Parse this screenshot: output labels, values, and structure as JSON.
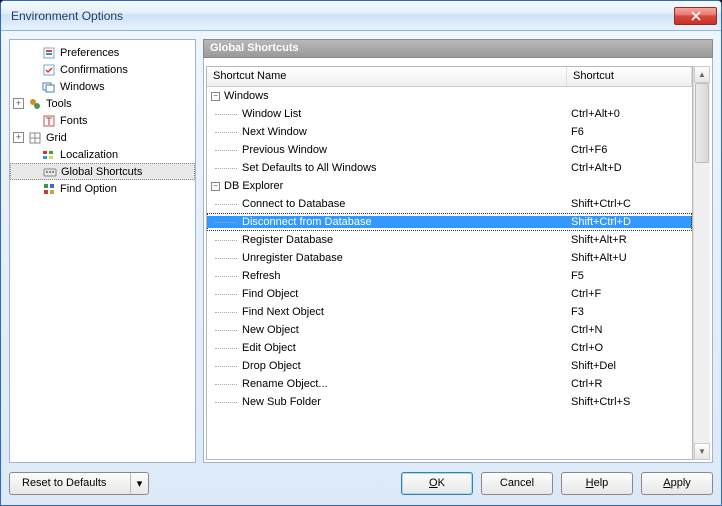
{
  "window": {
    "title": "Environment Options"
  },
  "tree": [
    {
      "label": "Preferences",
      "indent": 1,
      "expand": null,
      "icon": "prefs"
    },
    {
      "label": "Confirmations",
      "indent": 1,
      "expand": null,
      "icon": "confirm"
    },
    {
      "label": "Windows",
      "indent": 1,
      "expand": null,
      "icon": "windows"
    },
    {
      "label": "Tools",
      "indent": 0,
      "expand": "+",
      "icon": "tools"
    },
    {
      "label": "Fonts",
      "indent": 1,
      "expand": null,
      "icon": "fonts"
    },
    {
      "label": "Grid",
      "indent": 0,
      "expand": "+",
      "icon": "grid"
    },
    {
      "label": "Localization",
      "indent": 1,
      "expand": null,
      "icon": "local"
    },
    {
      "label": "Global Shortcuts",
      "indent": 1,
      "expand": null,
      "icon": "shortcut",
      "selected": true
    },
    {
      "label": "Find Option",
      "indent": 1,
      "expand": null,
      "icon": "find"
    }
  ],
  "section": {
    "title": "Global Shortcuts"
  },
  "columns": {
    "name": "Shortcut Name",
    "shortcut": "Shortcut"
  },
  "rows": [
    {
      "type": "group",
      "name": "Windows",
      "shortcut": ""
    },
    {
      "type": "item",
      "name": "Window List",
      "shortcut": "Ctrl+Alt+0"
    },
    {
      "type": "item",
      "name": "Next Window",
      "shortcut": "F6"
    },
    {
      "type": "item",
      "name": "Previous Window",
      "shortcut": "Ctrl+F6"
    },
    {
      "type": "item",
      "name": "Set Defaults to All Windows",
      "shortcut": "Ctrl+Alt+D"
    },
    {
      "type": "group",
      "name": "DB Explorer",
      "shortcut": ""
    },
    {
      "type": "item",
      "name": "Connect to Database",
      "shortcut": "Shift+Ctrl+C"
    },
    {
      "type": "item",
      "name": "Disconnect from Database",
      "shortcut": "Shift+Ctrl+D",
      "selected": true
    },
    {
      "type": "item",
      "name": "Register Database",
      "shortcut": "Shift+Alt+R"
    },
    {
      "type": "item",
      "name": "Unregister Database",
      "shortcut": "Shift+Alt+U"
    },
    {
      "type": "item",
      "name": "Refresh",
      "shortcut": "F5"
    },
    {
      "type": "item",
      "name": "Find Object",
      "shortcut": "Ctrl+F"
    },
    {
      "type": "item",
      "name": "Find Next Object",
      "shortcut": "F3"
    },
    {
      "type": "item",
      "name": "New Object",
      "shortcut": "Ctrl+N"
    },
    {
      "type": "item",
      "name": "Edit Object",
      "shortcut": "Ctrl+O"
    },
    {
      "type": "item",
      "name": "Drop Object",
      "shortcut": "Shift+Del"
    },
    {
      "type": "item",
      "name": "Rename Object...",
      "shortcut": "Ctrl+R"
    },
    {
      "type": "item",
      "name": "New Sub Folder",
      "shortcut": "Shift+Ctrl+S"
    }
  ],
  "buttons": {
    "reset": "Reset to Defaults",
    "ok": "OK",
    "cancel": "Cancel",
    "help": "Help",
    "apply": "Apply"
  }
}
